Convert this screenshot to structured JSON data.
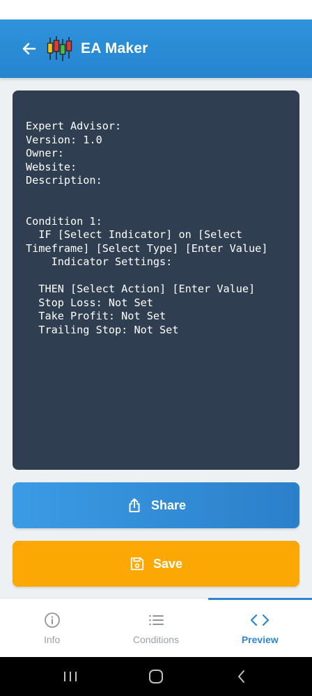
{
  "app": {
    "title": "EA Maker"
  },
  "preview": {
    "code": "Expert Advisor:\nVersion: 1.0\nOwner:\nWebsite:\nDescription:\n\n\nCondition 1:\n  IF [Select Indicator] on [Select Timeframe] [Select Type] [Enter Value]\n    Indicator Settings:\n\n  THEN [Select Action] [Enter Value]\n  Stop Loss: Not Set\n  Take Profit: Not Set\n  Trailing Stop: Not Set"
  },
  "actions": {
    "share_label": "Share",
    "save_label": "Save"
  },
  "bottom_nav": {
    "items": [
      {
        "label": "Info",
        "icon": "info-icon"
      },
      {
        "label": "Conditions",
        "icon": "list-icon"
      },
      {
        "label": "Preview",
        "icon": "code-icon"
      }
    ],
    "active": "Preview"
  },
  "colors": {
    "primary": "#2c86d1",
    "panel": "#2f3e50",
    "save": "#fba704",
    "nav_inactive": "#9aa1a8"
  }
}
